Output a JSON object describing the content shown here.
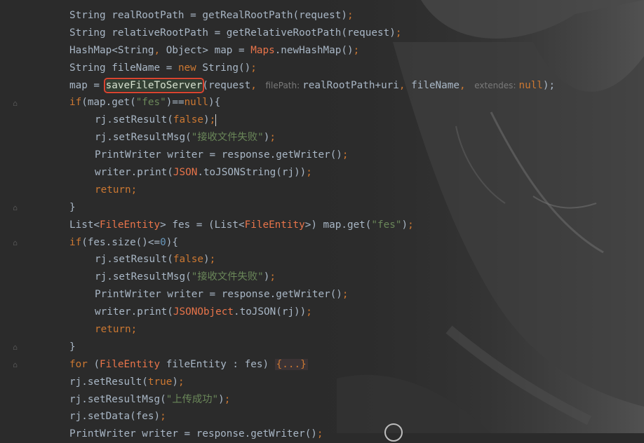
{
  "editor": {
    "lines": [
      {
        "indent": 0,
        "tokens": [
          [
            "String realRootPath = getRealRootPath(request)",
            ""
          ],
          [
            ";",
            "kw"
          ]
        ]
      },
      {
        "indent": 0,
        "tokens": [
          [
            "String relativeRootPath = getRelativeRootPath(request)",
            ""
          ],
          [
            ";",
            "kw"
          ]
        ]
      },
      {
        "indent": 0,
        "tokens": [
          [
            "HashMap<String",
            ""
          ],
          [
            ", ",
            "kw"
          ],
          [
            "Object> map = ",
            ""
          ],
          [
            "Maps",
            "cls"
          ],
          [
            ".newHashMap()",
            ""
          ],
          [
            ";",
            "kw"
          ]
        ]
      },
      {
        "indent": 0,
        "tokens": [
          [
            "String fileName = ",
            ""
          ],
          [
            "new ",
            "kw"
          ],
          [
            "String()",
            ""
          ],
          [
            ";",
            "kw"
          ]
        ]
      },
      {
        "indent": 0,
        "tokens": [
          [
            "map = ",
            ""
          ],
          [
            "saveFileToServer",
            "hl"
          ],
          [
            "(request",
            ""
          ],
          [
            ", ",
            "kw"
          ],
          [
            "filePath:",
            "hint"
          ],
          [
            "realRootPath+uri",
            ""
          ],
          [
            ", ",
            "kw"
          ],
          [
            "fileName",
            ""
          ],
          [
            ", ",
            "kw"
          ],
          [
            "extendes:",
            "hint"
          ],
          [
            "null",
            "kw"
          ],
          [
            ");",
            ""
          ]
        ]
      },
      {
        "indent": 0,
        "tokens": [
          [
            "if",
            "kw"
          ],
          [
            "(map.get(",
            ""
          ],
          [
            "\"fes\"",
            "str"
          ],
          [
            ")==",
            ""
          ],
          [
            "null",
            "kw"
          ],
          [
            "){",
            ""
          ]
        ]
      },
      {
        "indent": 1,
        "tokens": [
          [
            "rj.setResult(",
            ""
          ],
          [
            "false",
            "kw"
          ],
          [
            ")",
            ""
          ],
          [
            ";",
            "kw"
          ],
          [
            "",
            "caret"
          ]
        ]
      },
      {
        "indent": 1,
        "tokens": [
          [
            "rj.setResultMsg(",
            ""
          ],
          [
            "\"接收文件失败\"",
            "str"
          ],
          [
            ")",
            ""
          ],
          [
            ";",
            "kw"
          ]
        ]
      },
      {
        "indent": 1,
        "tokens": [
          [
            "PrintWriter writer = response.getWriter()",
            ""
          ],
          [
            ";",
            "kw"
          ]
        ]
      },
      {
        "indent": 1,
        "tokens": [
          [
            "writer.print(",
            ""
          ],
          [
            "JSON",
            "cls"
          ],
          [
            ".toJSONString(rj))",
            ""
          ],
          [
            ";",
            "kw"
          ]
        ]
      },
      {
        "indent": 1,
        "tokens": [
          [
            "return",
            "kw"
          ],
          [
            ";",
            "kw"
          ]
        ]
      },
      {
        "indent": 0,
        "tokens": [
          [
            "}",
            ""
          ]
        ]
      },
      {
        "indent": 0,
        "tokens": [
          [
            "List<",
            ""
          ],
          [
            "FileEntity",
            "cls"
          ],
          [
            "> fes = (List<",
            ""
          ],
          [
            "FileEntity",
            "cls"
          ],
          [
            ">) map.get(",
            ""
          ],
          [
            "\"fes\"",
            "str"
          ],
          [
            ")",
            ""
          ],
          [
            ";",
            "kw"
          ]
        ]
      },
      {
        "indent": 0,
        "tokens": [
          [
            "if",
            "kw"
          ],
          [
            "(fes.size()<=",
            ""
          ],
          [
            "0",
            "num"
          ],
          [
            "){",
            ""
          ]
        ]
      },
      {
        "indent": 1,
        "tokens": [
          [
            "rj.setResult(",
            ""
          ],
          [
            "false",
            "kw"
          ],
          [
            ")",
            ""
          ],
          [
            ";",
            "kw"
          ]
        ]
      },
      {
        "indent": 1,
        "tokens": [
          [
            "rj.setResultMsg(",
            ""
          ],
          [
            "\"接收文件失败\"",
            "str"
          ],
          [
            ")",
            ""
          ],
          [
            ";",
            "kw"
          ]
        ]
      },
      {
        "indent": 1,
        "tokens": [
          [
            "PrintWriter writer = response.getWriter()",
            ""
          ],
          [
            ";",
            "kw"
          ]
        ]
      },
      {
        "indent": 1,
        "tokens": [
          [
            "writer.print(",
            ""
          ],
          [
            "JSONObject",
            "cls"
          ],
          [
            ".toJSON(rj))",
            ""
          ],
          [
            ";",
            "kw"
          ]
        ]
      },
      {
        "indent": 1,
        "tokens": [
          [
            "return",
            "kw"
          ],
          [
            ";",
            "kw"
          ]
        ]
      },
      {
        "indent": 0,
        "tokens": [
          [
            "}",
            ""
          ]
        ]
      },
      {
        "indent": 0,
        "tokens": [
          [
            "for ",
            "kw"
          ],
          [
            "(",
            ""
          ],
          [
            "FileEntity",
            "cls"
          ],
          [
            " fileEntity : fes) ",
            ""
          ],
          [
            "{...}",
            "fold-text"
          ]
        ]
      },
      {
        "indent": 0,
        "tokens": [
          [
            "rj.setResult(",
            ""
          ],
          [
            "true",
            "kw"
          ],
          [
            ")",
            ""
          ],
          [
            ";",
            "kw"
          ]
        ]
      },
      {
        "indent": 0,
        "tokens": [
          [
            "rj.setResultMsg(",
            ""
          ],
          [
            "\"上传成功\"",
            "str"
          ],
          [
            ")",
            ""
          ],
          [
            ";",
            "kw"
          ]
        ]
      },
      {
        "indent": 0,
        "tokens": [
          [
            "rj.setData(fes)",
            ""
          ],
          [
            ";",
            "kw"
          ]
        ]
      },
      {
        "indent": 0,
        "tokens": [
          [
            "PrintWriter writer = response.getWriter()",
            ""
          ],
          [
            ";",
            "kw"
          ]
        ]
      }
    ]
  },
  "gutter": {
    "fold_markers": [
      5,
      11,
      13,
      19,
      20
    ],
    "fold_icon": "fold-marker-icon"
  },
  "theme": {
    "background": "#2b2b2b",
    "keyword": "#cc7832",
    "string": "#6a8759",
    "class_ref": "#e8744a",
    "number": "#6897bb",
    "default_text": "#a9b7c6",
    "highlight_border": "#d9452f"
  }
}
